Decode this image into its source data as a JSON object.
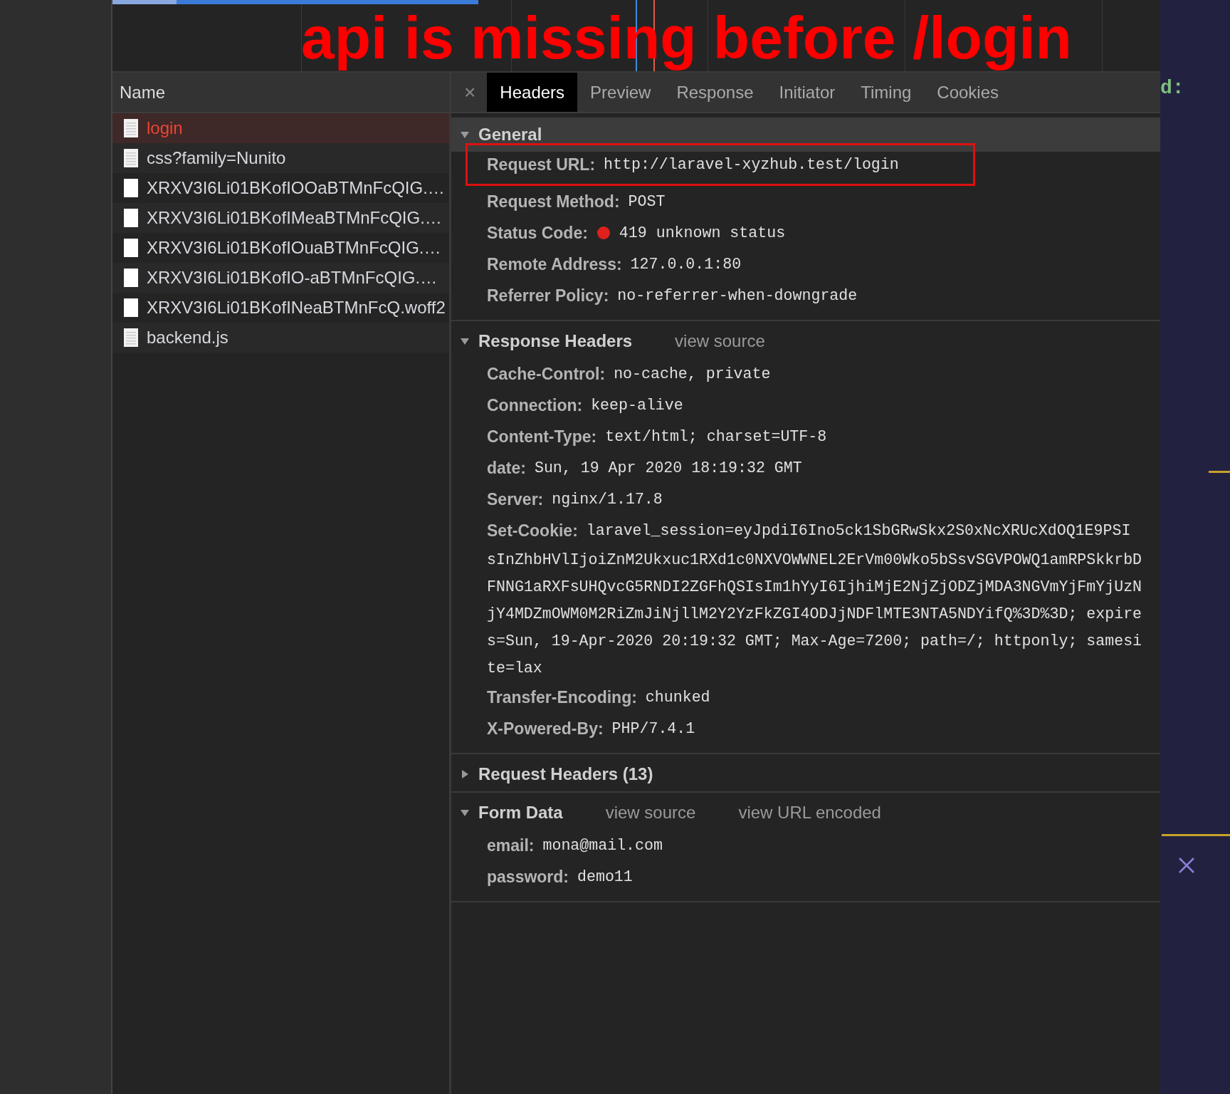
{
  "annotation": "api is missing before /login",
  "requests": {
    "column": "Name",
    "items": [
      {
        "name": "login",
        "kind": "document",
        "selected": true,
        "failed": true
      },
      {
        "name": "css?family=Nunito",
        "kind": "document",
        "selected": false,
        "failed": false
      },
      {
        "name": "XRXV3I6Li01BKofIOOaBTMnFcQIG.…",
        "kind": "font",
        "selected": false,
        "failed": false
      },
      {
        "name": "XRXV3I6Li01BKofIMeaBTMnFcQIG.…",
        "kind": "font",
        "selected": false,
        "failed": false
      },
      {
        "name": "XRXV3I6Li01BKofIOuaBTMnFcQIG.…",
        "kind": "font",
        "selected": false,
        "failed": false
      },
      {
        "name": "XRXV3I6Li01BKofIO-aBTMnFcQIG.…",
        "kind": "font",
        "selected": false,
        "failed": false
      },
      {
        "name": "XRXV3I6Li01BKofINeaBTMnFcQ.woff2",
        "kind": "font",
        "selected": false,
        "failed": false
      },
      {
        "name": "backend.js",
        "kind": "document",
        "selected": false,
        "failed": false
      }
    ]
  },
  "close_glyph": "×",
  "tabs": [
    {
      "label": "Headers",
      "selected": true
    },
    {
      "label": "Preview",
      "selected": false
    },
    {
      "label": "Response",
      "selected": false
    },
    {
      "label": "Initiator",
      "selected": false
    },
    {
      "label": "Timing",
      "selected": false
    },
    {
      "label": "Cookies",
      "selected": false
    }
  ],
  "sections": [
    {
      "title": "General",
      "expanded": true,
      "rows": [
        {
          "label": "Request URL:",
          "value": "http://laravel-xyzhub.test/login",
          "boxed": true
        },
        {
          "label": "Request Method:",
          "value": "POST"
        },
        {
          "label": "Status Code:",
          "value": "419 unknown status",
          "color": "#e0201c"
        },
        {
          "label": "Remote Address:",
          "value": "127.0.0.1:80"
        },
        {
          "label": "Referrer Policy:",
          "value": "no-referrer-when-downgrade"
        }
      ]
    },
    {
      "title": "Response Headers",
      "expanded": true,
      "links": [
        "view source"
      ],
      "rows": [
        {
          "label": "Cache-Control:",
          "value": "no-cache, private"
        },
        {
          "label": "Connection:",
          "value": "keep-alive"
        },
        {
          "label": "Content-Type:",
          "value": "text/html; charset=UTF-8"
        },
        {
          "label": "date:",
          "value": "Sun, 19 Apr 2020 18:19:32 GMT"
        },
        {
          "label": "Server:",
          "value": "nginx/1.17.8"
        },
        {
          "label": "Set-Cookie:",
          "value": "laravel_session=eyJpdiI6Ino5ck1SbGRwSkx2S0xNcXRUcXdOQ1E9PSI",
          "more_lines": [
            "sInZhbHVlIjoiZnM2Ukxuc1RXd1c0NXVOWWNEL2ErVm00Wko5bSsvSGVPOWQ1amRPSkkrbD",
            "FNNG1aRXFsUHQvcG5RNDI2ZGFhQSIsIm1hYyI6IjhiMjE2NjZjODZjMDA3NGVmYjFmYjUzN",
            "jY4MDZmOWM0M2RiZmJiNjllM2Y2YzFkZGI4ODJjNDFlMTE3NTA5NDYifQ%3D%3D; expire",
            "s=Sun, 19-Apr-2020 20:19:32 GMT; Max-Age=7200; path=/; httponly; samesi",
            "te=lax"
          ]
        },
        {
          "label": "Transfer-Encoding:",
          "value": "chunked"
        },
        {
          "label": "X-Powered-By:",
          "value": "PHP/7.4.1"
        }
      ]
    },
    {
      "title": "Request Headers (13)",
      "expanded": false
    },
    {
      "title": "Form Data",
      "expanded": true,
      "links": [
        "view source",
        "view URL encoded"
      ],
      "rows": [
        {
          "label": "email:",
          "value": "mona@mail.com"
        },
        {
          "label": "password:",
          "value": "demo11"
        }
      ]
    }
  ],
  "editor": {
    "text": "d:"
  }
}
